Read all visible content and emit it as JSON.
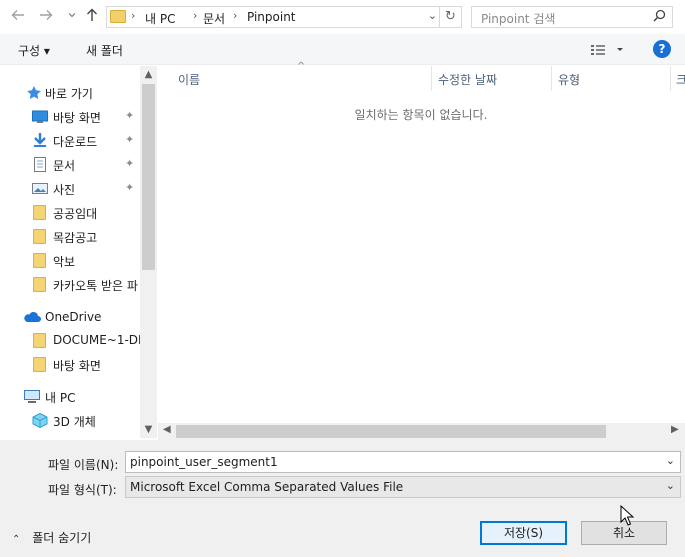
{
  "nav": {
    "back_icon": "arrow-left-icon",
    "forward_icon": "arrow-right-icon",
    "recent_icon": "chevron-down-icon",
    "up_icon": "arrow-up-icon",
    "breadcrumbs": [
      "내 PC",
      "문서",
      "Pinpoint"
    ],
    "search_placeholder": "Pinpoint 검색"
  },
  "toolbar": {
    "organize_label": "구성 ▾",
    "new_folder_label": "새 폴더"
  },
  "sidebar": {
    "quick_access": "바로 가기",
    "items": [
      {
        "label": "바탕 화면",
        "icon": "desktop-icon",
        "pinned": true
      },
      {
        "label": "다운로드",
        "icon": "download-icon",
        "pinned": true
      },
      {
        "label": "문서",
        "icon": "document-icon",
        "pinned": true
      },
      {
        "label": "사진",
        "icon": "pictures-icon",
        "pinned": true
      },
      {
        "label": "공공임대",
        "icon": "folder-icon",
        "pinned": false
      },
      {
        "label": "목감공고",
        "icon": "folder-icon",
        "pinned": false
      },
      {
        "label": "악보",
        "icon": "folder-icon",
        "pinned": false
      },
      {
        "label": "카카오톡 받은 파",
        "icon": "folder-icon",
        "pinned": false
      }
    ],
    "onedrive": "OneDrive",
    "onedrive_items": [
      {
        "label": "DOCUME~1-DE",
        "icon": "folder-icon"
      },
      {
        "label": "바탕 화면",
        "icon": "folder-icon"
      }
    ],
    "this_pc": "내 PC",
    "pc_items": [
      {
        "label": "3D 개체",
        "icon": "cube-3d-icon"
      }
    ]
  },
  "file_list": {
    "columns": [
      "이름",
      "수정한 날짜",
      "유형",
      "크"
    ],
    "empty_message": "일치하는 항목이 없습니다."
  },
  "bottom": {
    "filename_label": "파일 이름(N):",
    "filename_value": "pinpoint_user_segment1",
    "filetype_label": "파일 형식(T):",
    "filetype_value": "Microsoft Excel Comma Separated Values File",
    "hide_folders_label": "폴더 숨기기",
    "save_label": "저장(S)",
    "cancel_label": "취소"
  },
  "colors": {
    "accent": "#0078d7",
    "help_blue": "#1a6fd6",
    "folder_yellow": "#f6d474"
  }
}
